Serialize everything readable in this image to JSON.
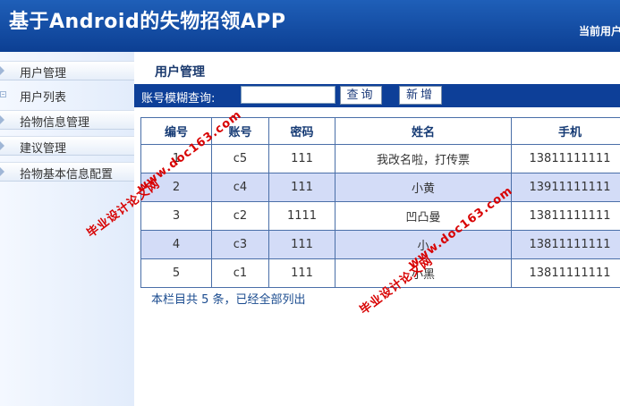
{
  "app": {
    "title": "基于Android的失物招领APP",
    "current_user_label": "当前用户"
  },
  "sidebar": {
    "items": [
      {
        "label": "用户管理"
      },
      {
        "label": "用户列表"
      },
      {
        "label": "拾物信息管理"
      },
      {
        "label": "建议管理"
      },
      {
        "label": "拾物基本信息配置"
      }
    ]
  },
  "main": {
    "title": "用户管理",
    "search_label": "账号模糊查询:",
    "search_value": "",
    "query_button": "查询",
    "add_button": "新增",
    "columns": [
      "编号",
      "账号",
      "密码",
      "姓名",
      "手机"
    ],
    "rows": [
      {
        "id": "1",
        "account": "c5",
        "password": "111",
        "name": "我改名啦，打传票",
        "phone": "13811111111"
      },
      {
        "id": "2",
        "account": "c4",
        "password": "111",
        "name": "小黄",
        "phone": "13911111111"
      },
      {
        "id": "3",
        "account": "c2",
        "password": "1111",
        "name": "凹凸曼",
        "phone": "13811111111"
      },
      {
        "id": "4",
        "account": "c3",
        "password": "111",
        "name": "小",
        "phone": "13811111111"
      },
      {
        "id": "5",
        "account": "c1",
        "password": "111",
        "name": "小黑",
        "phone": "13811111111"
      }
    ],
    "summary": "本栏目共 5 条，已经全部列出"
  },
  "watermark": {
    "site_name": "毕业设计论文网",
    "url": "www.doc163.com"
  },
  "colors": {
    "header": "#0c3f93",
    "toolbar": "#0d3f98",
    "row_highlight": "#d3dcf7",
    "watermark": "#d80000"
  }
}
